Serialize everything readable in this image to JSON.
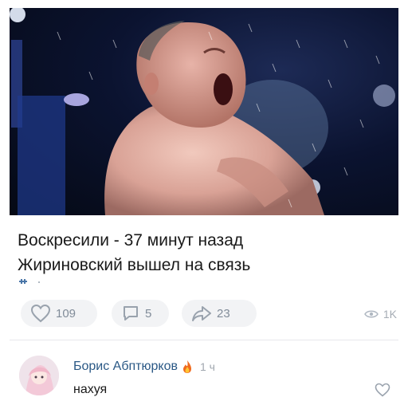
{
  "post": {
    "text_line1": "Воскресили - 37 минут назад",
    "text_line2": "Жириновский вышел на связь"
  },
  "actions": {
    "likes": "109",
    "comments": "5",
    "shares": "23",
    "views": "1K"
  },
  "comment": {
    "author": "Борис Абптюрков",
    "time": "1 ч",
    "text": "нахуя"
  },
  "colors": {
    "link": "#2a5885",
    "muted": "#818c99",
    "pill": "#f2f3f5"
  },
  "icons": [
    "heart-icon",
    "comment-icon",
    "share-icon",
    "eye-icon",
    "flame-icon",
    "comment-like-icon"
  ]
}
